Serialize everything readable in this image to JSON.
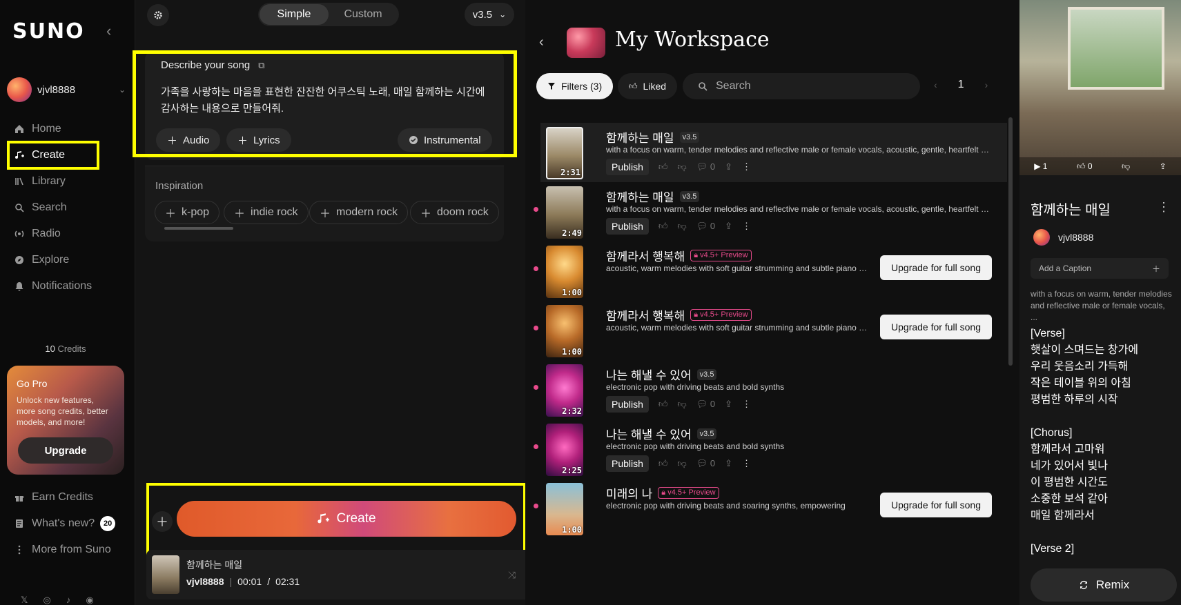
{
  "sidebar": {
    "logo": "SUNO",
    "user": "vjvl8888",
    "nav": [
      "Home",
      "Create",
      "Library",
      "Search",
      "Radio",
      "Explore",
      "Notifications"
    ],
    "credits_count": "10",
    "credits_label": "Credits",
    "gopro_title": "Go Pro",
    "gopro_text": "Unlock new features, more song credits, better models, and more!",
    "upgrade": "Upgrade",
    "bottom": [
      "Earn Credits",
      "What's new?",
      "More from Suno"
    ],
    "whats_new_count": "20",
    "social": [
      "𝕏",
      "◎",
      "♪",
      "◉"
    ]
  },
  "create": {
    "mode_simple": "Simple",
    "mode_custom": "Custom",
    "version": "v3.5",
    "describe_title": "Describe your song",
    "describe_text": "가족을 사랑하는 마음을 표현한 잔잔한 어쿠스틱 노래, 매일 함께하는 시간에 감사하는 내용으로 만들어줘.",
    "audio": "Audio",
    "lyrics": "Lyrics",
    "instrumental": "Instrumental",
    "inspiration": "Inspiration",
    "tags": [
      "k-pop",
      "indie rock",
      "modern rock",
      "doom rock"
    ],
    "create_label": "Create"
  },
  "player": {
    "title": "함께하는 매일",
    "user": "vjvl8888",
    "time": "00:01",
    "duration": "02:31"
  },
  "workspace": {
    "title": "My Workspace",
    "filters": "Filters (3)",
    "liked": "Liked",
    "search_placeholder": "Search",
    "page": "1",
    "upgrade_label": "Upgrade for full song",
    "publish_label": "Publish",
    "songs": [
      {
        "title": "함께하는 매일",
        "badge": "v3.5",
        "desc": "with a focus on warm, tender melodies and reflective male or female vocals, acoustic, gentle, heartfelt with...",
        "dur": "2:31",
        "count": "0"
      },
      {
        "title": "함께하는 매일",
        "badge": "v3.5",
        "desc": "with a focus on warm, tender melodies and reflective male or female vocals, acoustic, gentle, heartfelt with...",
        "dur": "2:49",
        "count": "0"
      },
      {
        "title": "함께라서 행복해",
        "badge": "v4.5+ Preview",
        "desc": "acoustic, warm melodies with soft guitar strumming and subtle piano ac...",
        "dur": "1:00"
      },
      {
        "title": "함께라서 행복해",
        "badge": "v4.5+ Preview",
        "desc": "acoustic, warm melodies with soft guitar strumming and subtle piano ac...",
        "dur": "1:00"
      },
      {
        "title": "나는 해낼 수 있어",
        "badge": "v3.5",
        "desc": "electronic pop with driving beats and bold synths",
        "dur": "2:32",
        "count": "0"
      },
      {
        "title": "나는 해낼 수 있어",
        "badge": "v3.5",
        "desc": "electronic pop with driving beats and bold synths",
        "dur": "2:25",
        "count": "0"
      },
      {
        "title": "미래의 나",
        "badge": "v4.5+ Preview",
        "desc": "electronic pop with driving beats and soaring synths, empowering",
        "dur": "1:00"
      }
    ]
  },
  "detail": {
    "plays": "1",
    "likes": "0",
    "title": "함께하는 매일",
    "user": "vjvl8888",
    "caption": "Add a Caption",
    "desc": "with a focus on warm, tender melodies and reflective male or female vocals, ...",
    "lyrics": "[Verse]\n햇살이 스며드는 창가에\n우리 웃음소리 가득해\n작은 테이블 위의 아침\n평범한 하루의 시작\n\n[Chorus]\n함께라서 고마워\n네가 있어서 빛나\n이 평범한 시간도\n소중한 보석 같아\n매일 함께라서\n\n[Verse 2]",
    "remix": "Remix"
  },
  "colors": {
    "accent": "#e94b8c",
    "highlight": "#ffff00"
  }
}
